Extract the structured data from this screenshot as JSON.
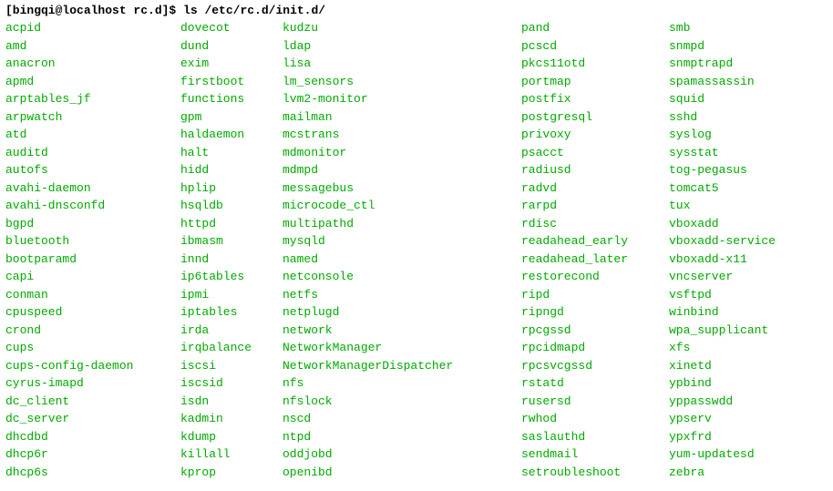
{
  "prompt": {
    "user_host": "[bingqi@localhost rc.d]$",
    "command": "ls /etc/rc.d/init.d/"
  },
  "columns": [
    [
      "acpid",
      "amd",
      "anacron",
      "apmd",
      "arptables_jf",
      "arpwatch",
      "atd",
      "auditd",
      "autofs",
      "avahi-daemon",
      "avahi-dnsconfd",
      "bgpd",
      "bluetooth",
      "bootparamd",
      "capi",
      "conman",
      "cpuspeed",
      "crond",
      "cups",
      "cups-config-daemon",
      "cyrus-imapd",
      "dc_client",
      "dc_server",
      "dhcdbd",
      "dhcp6r",
      "dhcp6s"
    ],
    [
      "dovecot",
      "dund",
      "exim",
      "firstboot",
      "functions",
      "gpm",
      "haldaemon",
      "halt",
      "hidd",
      "hplip",
      "hsqldb",
      "httpd",
      "ibmasm",
      "innd",
      "ip6tables",
      "ipmi",
      "iptables",
      "irda",
      "irqbalance",
      "iscsi",
      "iscsid",
      "isdn",
      "kadmin",
      "kdump",
      "killall",
      "kprop"
    ],
    [
      "kudzu",
      "ldap",
      "lisa",
      "lm_sensors",
      "lvm2-monitor",
      "mailman",
      "mcstrans",
      "mdmonitor",
      "mdmpd",
      "messagebus",
      "microcode_ctl",
      "multipathd",
      "mysqld",
      "named",
      "netconsole",
      "netfs",
      "netplugd",
      "network",
      "NetworkManager",
      "NetworkManagerDispatcher",
      "nfs",
      "nfslock",
      "nscd",
      "ntpd",
      "oddjobd",
      "openibd"
    ],
    [
      "pand",
      "pcscd",
      "pkcs11otd",
      "portmap",
      "postfix",
      "postgresql",
      "privoxy",
      "psacct",
      "radiusd",
      "radvd",
      "rarpd",
      "rdisc",
      "readahead_early",
      "readahead_later",
      "restorecond",
      "ripd",
      "ripngd",
      "rpcgssd",
      "rpcidmapd",
      "rpcsvcgssd",
      "rstatd",
      "rusersd",
      "rwhod",
      "saslauthd",
      "sendmail",
      "setroubleshoot"
    ],
    [
      "smb",
      "snmpd",
      "snmptrapd",
      "spamassassin",
      "squid",
      "sshd",
      "syslog",
      "sysstat",
      "tog-pegasus",
      "tomcat5",
      "tux",
      "vboxadd",
      "vboxadd-service",
      "vboxadd-x11",
      "vncserver",
      "vsftpd",
      "winbind",
      "wpa_supplicant",
      "xfs",
      "xinetd",
      "ypbind",
      "yppasswdd",
      "ypserv",
      "ypxfrd",
      "yum-updatesd",
      "zebra"
    ]
  ]
}
